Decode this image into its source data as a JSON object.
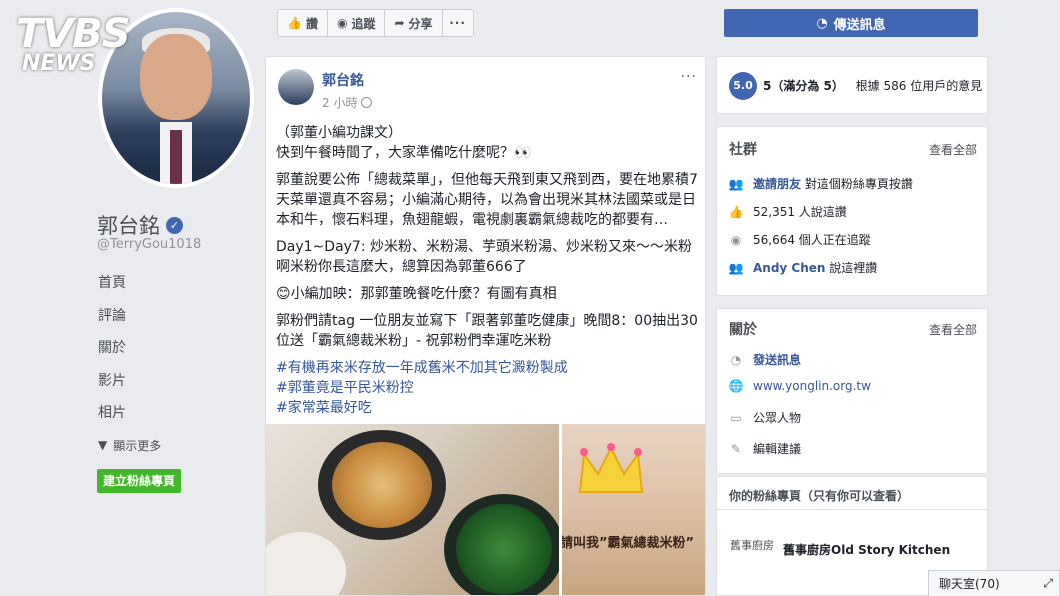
{
  "brand": {
    "logo_line1": "TVBS",
    "logo_line2": "NEWS"
  },
  "page": {
    "name": "郭台銘",
    "handle": "@TerryGou1018",
    "nav": [
      "首頁",
      "評論",
      "關於",
      "影片",
      "相片"
    ],
    "nav_more": "顯示更多",
    "create_page": "建立粉絲專頁"
  },
  "actions": {
    "like": "讚",
    "follow": "追蹤",
    "share": "分享",
    "more": "···"
  },
  "post": {
    "author": "郭台銘",
    "time": "2 小時",
    "menu": "···",
    "line1": "（郭董小編功課文）",
    "line2": "快到午餐時間了，大家準備吃什麼呢？👀",
    "para2": "郭董說要公佈「總裁菜單」，但他每天飛到東又飛到西，要在地累積7天菜單還真不容易；小編滿心期待，以為會出現米其林法國菜或是日本和牛，懷石料理，魚翅龍蝦，電視劇裏霸氣總裁吃的都要有…",
    "para3": "Day1~Day7: 炒米粉、米粉湯、芋頭米粉湯、炒米粉又來～～米粉啊米粉你長這麼大，總算因為郭董666了",
    "para4": "😊小編加映：那郭董晚餐吃什麼？有圖有真相",
    "para5": "郭粉們請tag 一位朋友並寫下「跟著郭董吃健康」晚間8：00抽出30位送「霸氣總裁米粉」- 祝郭粉們幸運吃米粉",
    "tags": [
      "#有機再來米存放一年成舊米不加其它澱粉製成",
      "#郭董竟是平民米粉控",
      "#家常菜最好吃"
    ],
    "photo2_text": "請叫我”霸氣總裁米粉”"
  },
  "right": {
    "send_message": "傳送訊息",
    "rating_value": "5.0",
    "rating_score": "5（滿分為 5）",
    "rating_basis": "根據 586 位用戶的意見",
    "community_title": "社群",
    "see_all": "查看全部",
    "invite_link": "邀請朋友",
    "invite_rest": " 對這個粉絲專頁按讚",
    "likes": "52,351 人說這讚",
    "follows": "56,664 個人正在追蹤",
    "friend_name": "Andy Chen",
    "friend_rest": " 說這裡讚",
    "about_title": "關於",
    "about_see_all": "查看全部",
    "about_message": "發送訊息",
    "about_website": "www.yonglin.org.tw",
    "about_category": "公眾人物",
    "about_edit": "編輯建議",
    "yours_title": "你的粉絲專頁（只有你可以查看）",
    "kitchen_logo": "舊事廚房",
    "kitchen_name": "舊事廚房Old Story Kitchen",
    "chat": "聊天室(70)"
  },
  "colors": {
    "fb_blue": "#4267b2",
    "link_blue": "#385898",
    "green": "#42b72a"
  }
}
